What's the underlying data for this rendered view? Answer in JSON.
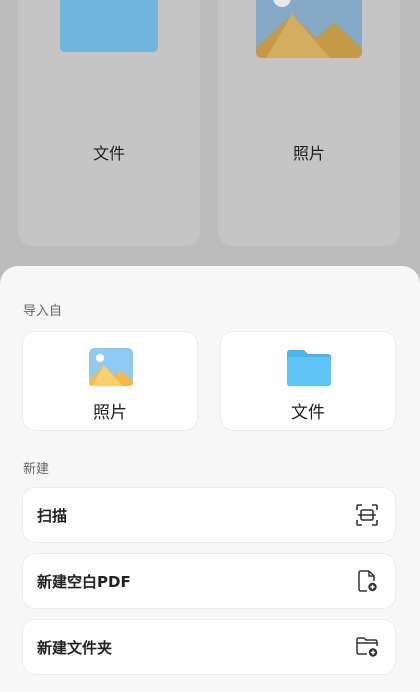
{
  "background": {
    "cards": [
      {
        "label": "文件",
        "icon": "folder-icon"
      },
      {
        "label": "照片",
        "icon": "photo-icon"
      }
    ]
  },
  "sheet": {
    "import_title": "导入自",
    "import_sources": [
      {
        "label": "照片",
        "icon": "photo-icon"
      },
      {
        "label": "文件",
        "icon": "folder-icon"
      }
    ],
    "new_title": "新建",
    "new_items": [
      {
        "label": "扫描",
        "icon": "scan-icon"
      },
      {
        "label": "新建空白PDF",
        "icon": "new-file-icon"
      },
      {
        "label": "新建文件夹",
        "icon": "new-folder-icon"
      }
    ]
  },
  "colors": {
    "folder_blue": "#5fc2f2",
    "photo_sky": "#7cc0ea",
    "photo_mountain": "#f5b642"
  }
}
